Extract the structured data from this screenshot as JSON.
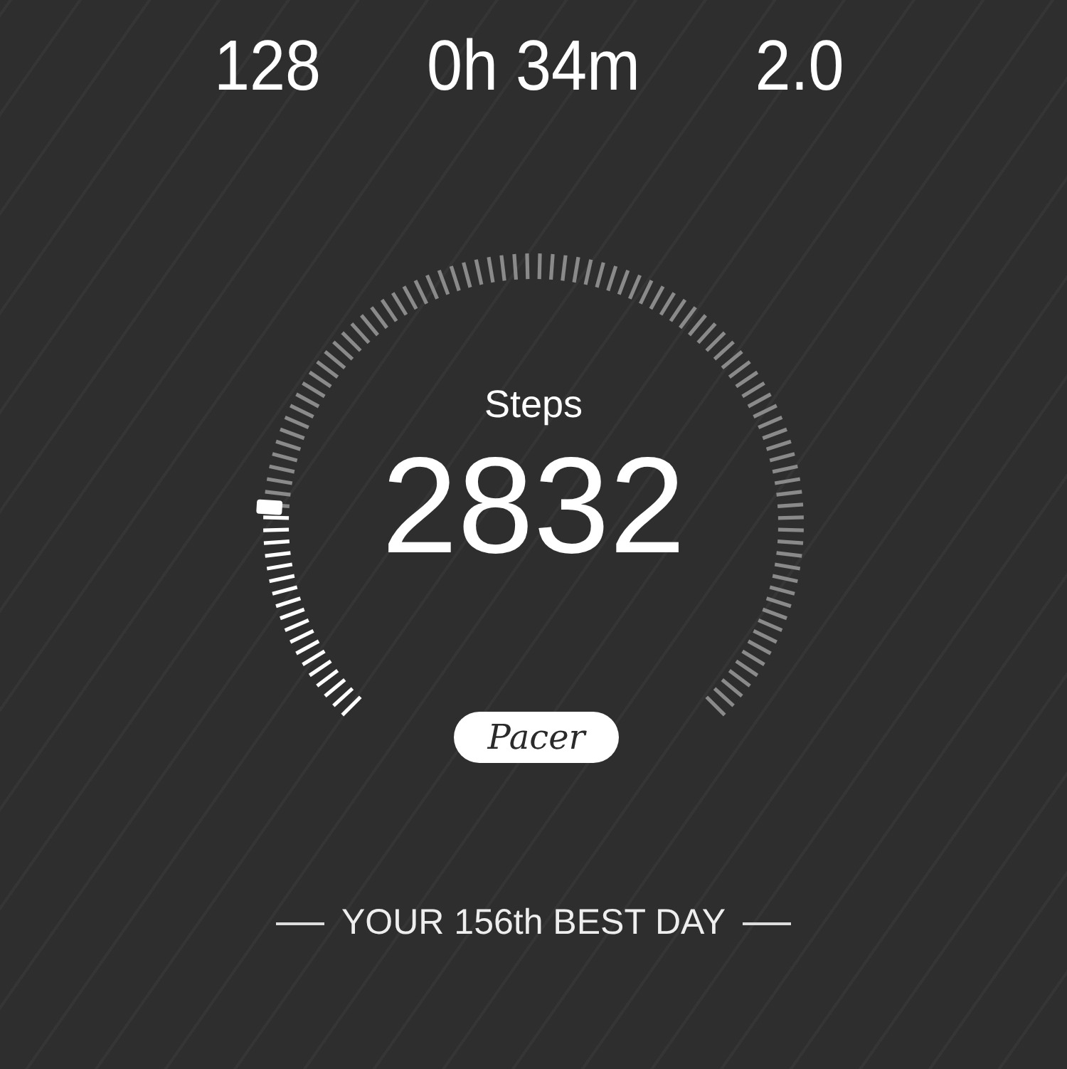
{
  "stats": [
    {
      "value": "128"
    },
    {
      "value": "0h 34m"
    },
    {
      "value": "2.0"
    }
  ],
  "gauge": {
    "label": "Steps",
    "value": "2832"
  },
  "brand": "Pacer",
  "footer": "YOUR 156th BEST DAY"
}
